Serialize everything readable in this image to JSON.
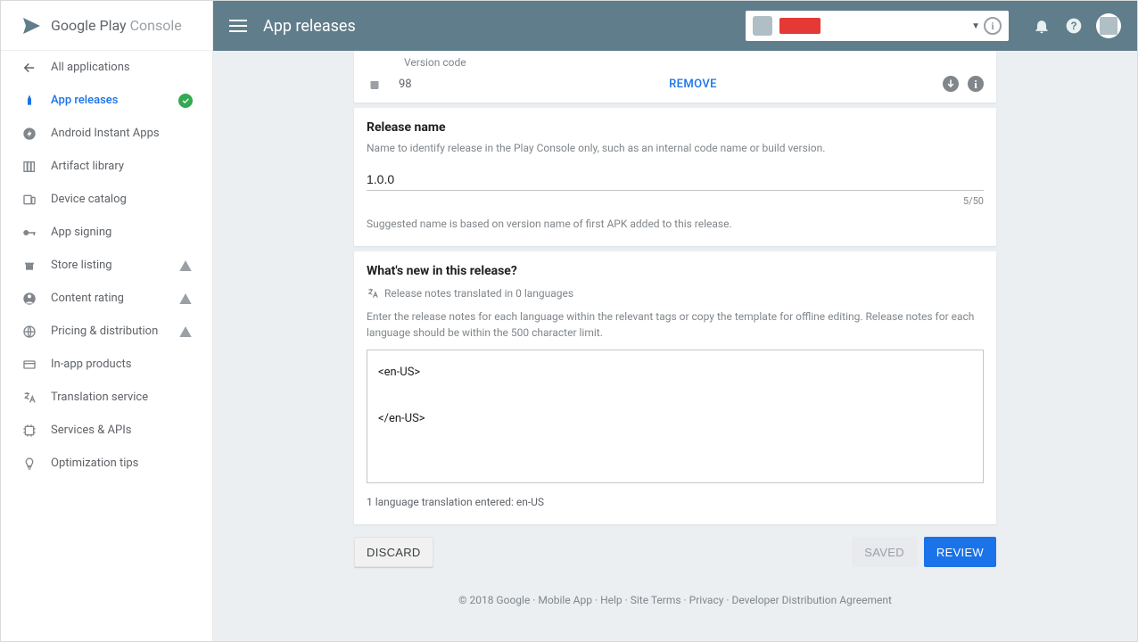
{
  "logo": {
    "main": "Google Play ",
    "suffix": "Console"
  },
  "sidebar": {
    "back": "All applications",
    "items": [
      {
        "label": "App releases",
        "icon": "releases",
        "status": "check"
      },
      {
        "label": "Android Instant Apps",
        "icon": "bolt"
      },
      {
        "label": "Artifact library",
        "icon": "library"
      },
      {
        "label": "Device catalog",
        "icon": "devices"
      },
      {
        "label": "App signing",
        "icon": "key"
      },
      {
        "label": "Store listing",
        "icon": "store",
        "status": "warn"
      },
      {
        "label": "Content rating",
        "icon": "person-shield",
        "status": "warn"
      },
      {
        "label": "Pricing & distribution",
        "icon": "globe",
        "status": "warn"
      },
      {
        "label": "In-app products",
        "icon": "card"
      },
      {
        "label": "Translation service",
        "icon": "translate"
      },
      {
        "label": "Services & APIs",
        "icon": "api"
      },
      {
        "label": "Optimization tips",
        "icon": "bulb"
      }
    ]
  },
  "topbar": {
    "title": "App releases"
  },
  "apk": {
    "version_code_label": "Version code",
    "version_code": "98",
    "remove": "REMOVE"
  },
  "release_name": {
    "title": "Release name",
    "sub": "Name to identify release in the Play Console only, such as an internal code name or build version.",
    "value": "1.0.0",
    "count": "5/50",
    "hint": "Suggested name is based on version name of first APK added to this release."
  },
  "whats_new": {
    "title": "What's new in this release?",
    "translated": "Release notes translated in 0 languages",
    "desc": "Enter the release notes for each language within the relevant tags or copy the template for offline editing. Release notes for each language should be within the 500 character limit.",
    "notes": "<en-US>\n\n</en-US>",
    "entered": "1 language translation entered: en-US"
  },
  "buttons": {
    "discard": "DISCARD",
    "saved": "SAVED",
    "review": "REVIEW"
  },
  "footer": {
    "copyright": "© 2018 Google",
    "links": [
      "Mobile App",
      "Help",
      "Site Terms",
      "Privacy",
      "Developer Distribution Agreement"
    ]
  }
}
